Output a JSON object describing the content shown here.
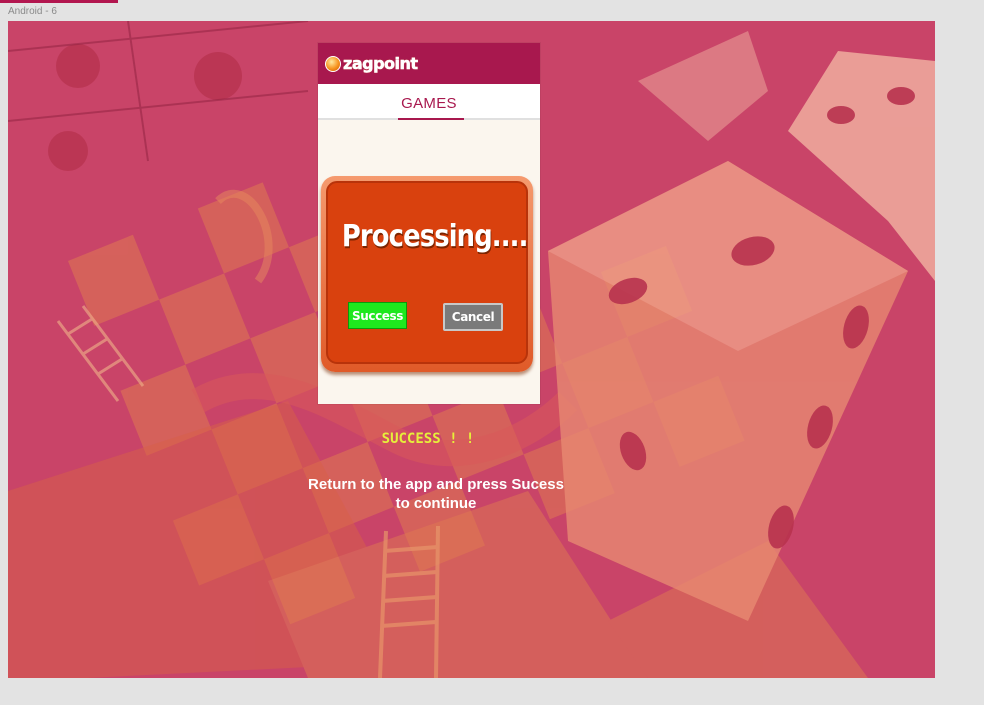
{
  "frame": {
    "label": "Android - 6"
  },
  "app": {
    "logo_text": "zagpoint",
    "tab_label": "GAMES"
  },
  "dialog": {
    "title": "Processing....",
    "success_label": "Success",
    "cancel_label": "Cancel"
  },
  "status": {
    "success_text": "SUCCESS ! !",
    "instruction_line1": "Return to the app and press Sucess",
    "instruction_line2": "to continue"
  },
  "colors": {
    "brand": "#a8184e",
    "overlay": "#c84266",
    "success_text": "#e6ef3a",
    "dialog": "#d9410e",
    "success_button": "#1ee81e",
    "cancel_button": "#7a7a7a"
  }
}
